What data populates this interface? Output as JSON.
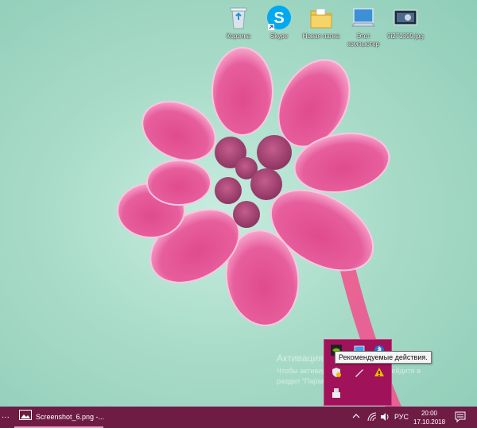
{
  "desktop": {
    "icons": [
      {
        "label": "Корзина",
        "icon": "recycle-bin-icon"
      },
      {
        "label": "Skype",
        "icon": "skype-icon"
      },
      {
        "label": "Новая папка",
        "icon": "folder-icon"
      },
      {
        "label": "Этот компьютер",
        "icon": "computer-icon"
      },
      {
        "label": "9i271399.jpg",
        "icon": "image-file-icon"
      }
    ]
  },
  "tray_popup": {
    "tooltip": "Рекомендуемые действия."
  },
  "activation": {
    "title": "Активация Windows",
    "line1": "Чтобы активировать Windows, перейдите в",
    "line2": "раздел \"Параметры\"."
  },
  "taskbar": {
    "task_label": "Screenshot_6.png -...",
    "language": "РУС",
    "time": "20:00",
    "date": "17.10.2018",
    "colors": {
      "taskbar": "#6e1c44",
      "accent": "#a0125a"
    }
  }
}
